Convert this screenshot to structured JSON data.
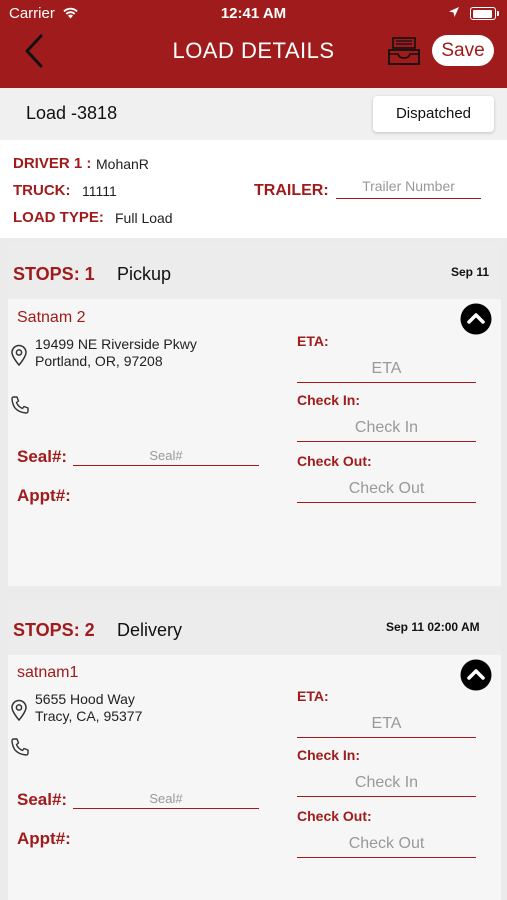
{
  "status_bar": {
    "carrier": "Carrier",
    "time": "12:41 AM"
  },
  "header": {
    "title": "LOAD DETAILS",
    "save_label": "Save",
    "back_icon": "chevron-left-icon",
    "inbox_icon": "inbox-tray-icon"
  },
  "load": {
    "id": "Load -3818",
    "status": "Dispatched"
  },
  "details": {
    "driver_label": "DRIVER 1 :",
    "driver_value": "MohanR",
    "truck_label": "TRUCK:",
    "truck_value": "11111",
    "trailer_label": "TRAILER:",
    "trailer_placeholder": "Trailer Number",
    "load_type_label": "LOAD TYPE:",
    "load_type_value": "Full Load"
  },
  "stops": [
    {
      "number": "STOPS: 1",
      "type": "Pickup",
      "date": "Sep 11",
      "name": "Satnam 2",
      "address_line1": "19499 NE Riverside Pkwy",
      "address_line2": "Portland, OR, 97208",
      "seal_label": "Seal#:",
      "seal_placeholder": "Seal#",
      "appt_label": "Appt#:",
      "eta_label": "ETA:",
      "eta_placeholder": "ETA",
      "checkin_label": "Check In:",
      "checkin_placeholder": "Check In",
      "checkout_label": "Check Out:",
      "checkout_placeholder": "Check Out"
    },
    {
      "number": "STOPS: 2",
      "type": "Delivery",
      "date": "Sep 11 02:00 AM",
      "name": "satnam1",
      "address_line1": "5655 Hood Way",
      "address_line2": "Tracy, CA, 95377",
      "seal_label": "Seal#:",
      "seal_placeholder": "Seal#",
      "appt_label": "Appt#:",
      "eta_label": "ETA:",
      "eta_placeholder": "ETA",
      "checkin_label": "Check In:",
      "checkin_placeholder": "Check In",
      "checkout_label": "Check Out:",
      "checkout_placeholder": "Check Out"
    }
  ],
  "colors": {
    "brand": "#a01c1c",
    "background": "#ebebeb"
  }
}
